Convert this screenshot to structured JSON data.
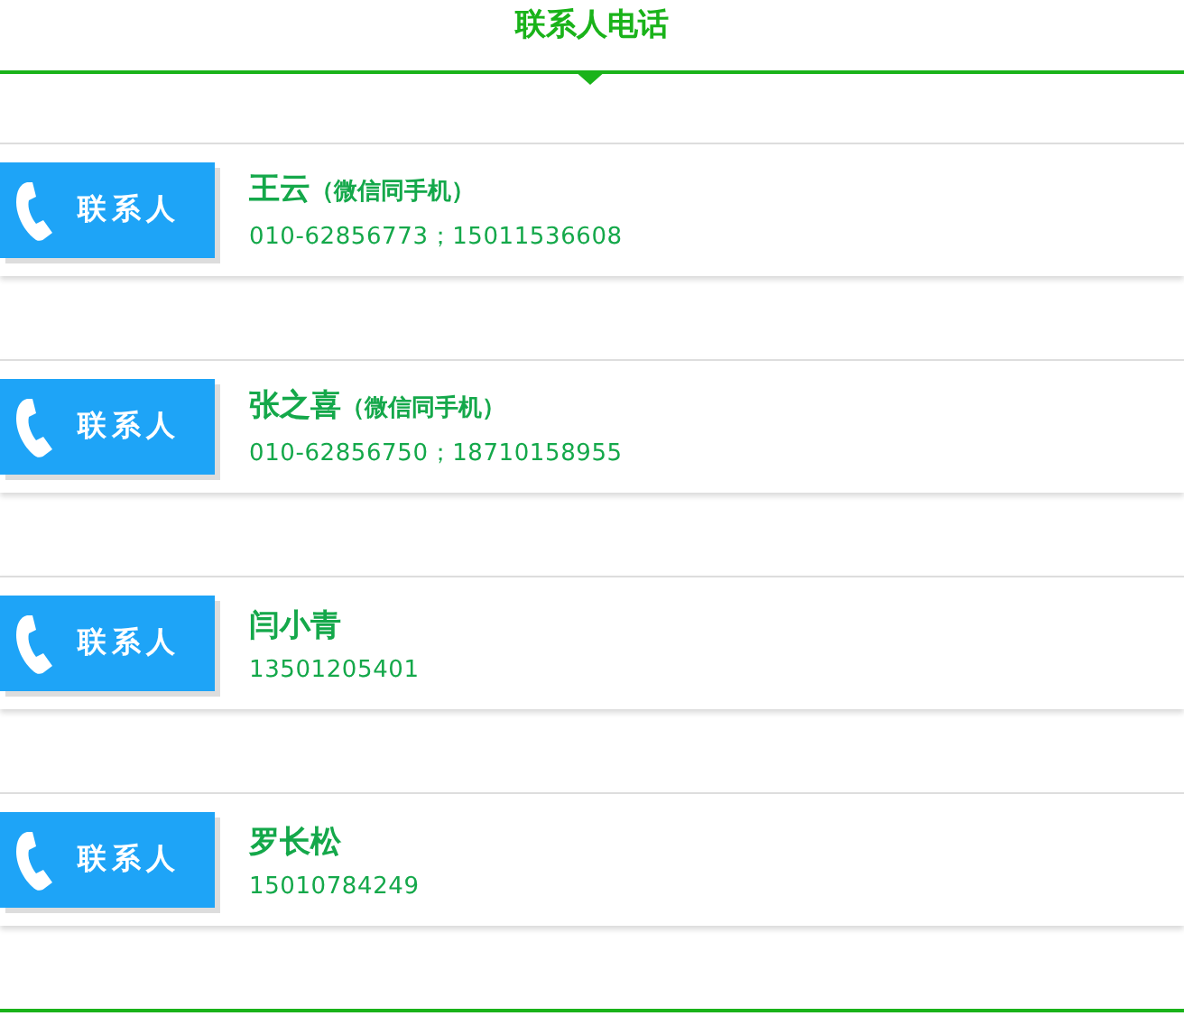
{
  "title": "联系人电话",
  "contacts": [
    {
      "badge": "联系人",
      "name": "王云",
      "note": "（微信同手机）",
      "phone": "010-62856773；15011536608"
    },
    {
      "badge": "联系人",
      "name": "张之喜",
      "note": "（微信同手机）",
      "phone": "010-62856750；18710158955"
    },
    {
      "badge": "联系人",
      "name": "闫小青",
      "phone": "13501205401"
    },
    {
      "badge": "联系人",
      "name": "罗长松",
      "phone": "15010784249"
    }
  ]
}
